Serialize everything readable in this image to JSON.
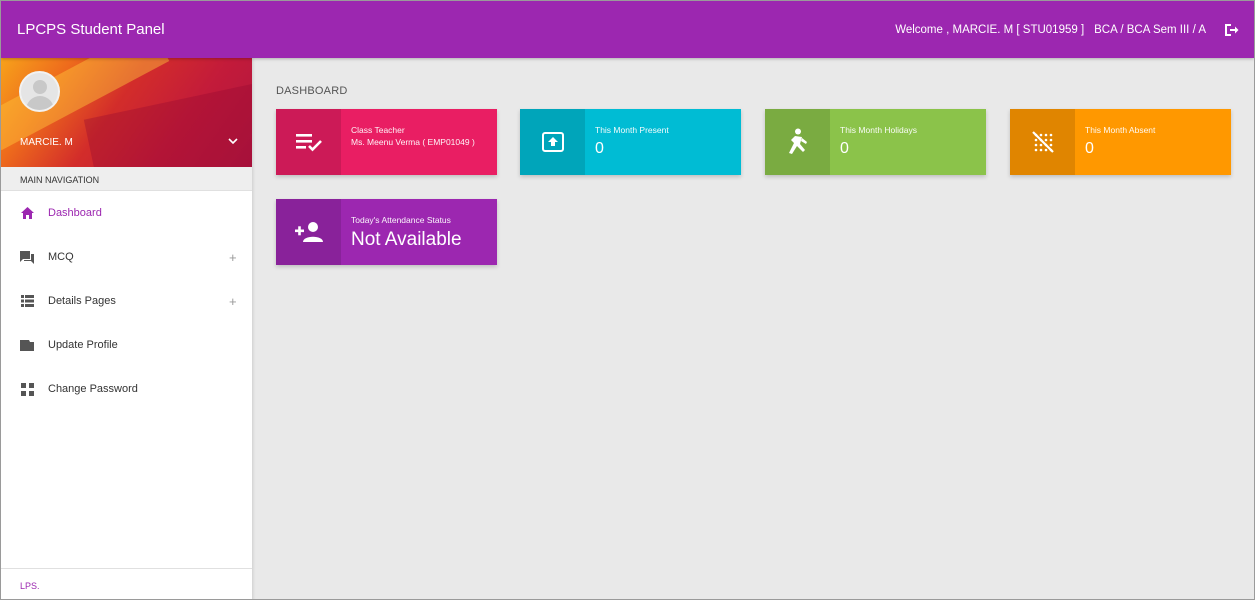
{
  "header": {
    "brand": "LPCPS Student Panel",
    "welcome": "Welcome , MARCIE. M [ STU01959 ]",
    "class_info": "BCA / BCA Sem III / A",
    "logout_icon": "logout-icon"
  },
  "sidebar": {
    "user_name": "MARCIE. M",
    "nav_header": "MAIN NAVIGATION",
    "items": [
      {
        "label": "Dashboard",
        "icon": "home-icon",
        "active": true
      },
      {
        "label": "MCQ",
        "icon": "forum-icon",
        "expandable": true,
        "expand_glyph": "+"
      },
      {
        "label": "Details Pages",
        "icon": "view-list-icon",
        "expandable": true,
        "expand_glyph": "+"
      },
      {
        "label": "Update Profile",
        "icon": "folder-icon"
      },
      {
        "label": "Change Password",
        "icon": "swap-icon"
      }
    ],
    "footer": "LPS."
  },
  "main": {
    "title": "DASHBOARD",
    "boxes": {
      "teacher": {
        "label": "Class Teacher",
        "value": "Ms. Meenu Verma ( EMP01049 )",
        "color": "#e91e63",
        "icon": "playlist-check-icon"
      },
      "present": {
        "label": "This Month Present",
        "value": "0",
        "color": "#00bcd4",
        "icon": "upload-box-icon"
      },
      "holidays": {
        "label": "This Month Holidays",
        "value": "0",
        "color": "#8bc34a",
        "icon": "person-running-icon"
      },
      "absent": {
        "label": "This Month Absent",
        "value": "0",
        "color": "#ff9800",
        "icon": "cancel-grid-icon"
      },
      "status": {
        "label": "Today's Attendance Status",
        "value": "Not Available",
        "color": "#9c27b0",
        "icon": "person-add-icon"
      }
    }
  },
  "colors": {
    "primary": "#9c27b0",
    "background": "#e9e9e9"
  }
}
